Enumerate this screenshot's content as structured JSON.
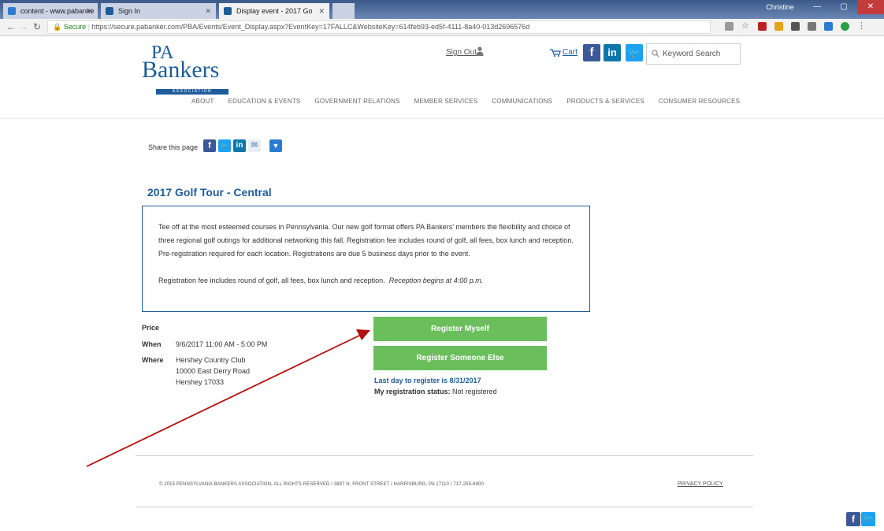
{
  "browser": {
    "tabs": [
      {
        "label": "content - www.pabanke",
        "active": false
      },
      {
        "label": "Sign In",
        "active": false
      },
      {
        "label": "Display event - 2017 Go",
        "active": true
      }
    ],
    "window_user": "Christine",
    "url_secure_label": "Secure",
    "url": "https://secure.pabanker.com/PBA/Events/Event_Display.aspx?EventKey=17FALLC&WebsiteKey=614feb93-ed5f-4111-8a40-013d2696576d"
  },
  "header": {
    "logo": {
      "line1": "PA",
      "line2": "Bankers",
      "line3": "ASSOCIATION"
    },
    "sign_out": "Sign Out",
    "cart": "Cart",
    "search_placeholder": "Keyword Search",
    "nav": [
      "ABOUT",
      "EDUCATION & EVENTS",
      "GOVERNMENT RELATIONS",
      "MEMBER SERVICES",
      "COMMUNICATIONS",
      "PRODUCTS & SERVICES",
      "CONSUMER RESOURCES"
    ]
  },
  "share": {
    "label": "Share this page"
  },
  "event": {
    "title": "2017 Golf Tour - Central",
    "description": "Tee off at the most esteemed courses in Pennsylvania. Our new golf format offers PA Bankers' members the flexibility and choice of three regional golf outings for additional networking this fall. Registration fee includes round of golf, all fees, box lunch and reception. Pre-registration required for each location. Registrations are due 5 business days prior to the event.",
    "fee_note": "Registration fee includes round of golf, all fees, box lunch and reception.",
    "reception_note": "Reception begins at 4:00 p.m.",
    "price_label": "Price",
    "when_label": "When",
    "when_value": "9/6/2017 11:00 AM - 5:00 PM",
    "where_label": "Where",
    "where_lines": [
      "Hershey Country Club",
      "10000 East Derry Road",
      "Hershey 17033"
    ],
    "register_myself": "Register Myself",
    "register_someone": "Register Someone Else",
    "last_day": "Last day to register is 8/31/2017",
    "status_label": "My registration status:",
    "status_value": "Not registered"
  },
  "footer": {
    "copyright": "© 2015 PENNSYLVANIA BANKERS ASSOCIATION, ALL RIGHTS RESERVED / 3897 N. FRONT STREET / HARRISBURG, PA 17110 / 717-255-6900",
    "privacy": "PRIVACY POLICY"
  },
  "colors": {
    "brand_blue": "#1f5c9a",
    "button_green": "#6abf5c",
    "arrow_red": "#b31010",
    "facebook": "#3b5998",
    "linkedin": "#0e76a8",
    "twitter": "#1da1f2"
  }
}
